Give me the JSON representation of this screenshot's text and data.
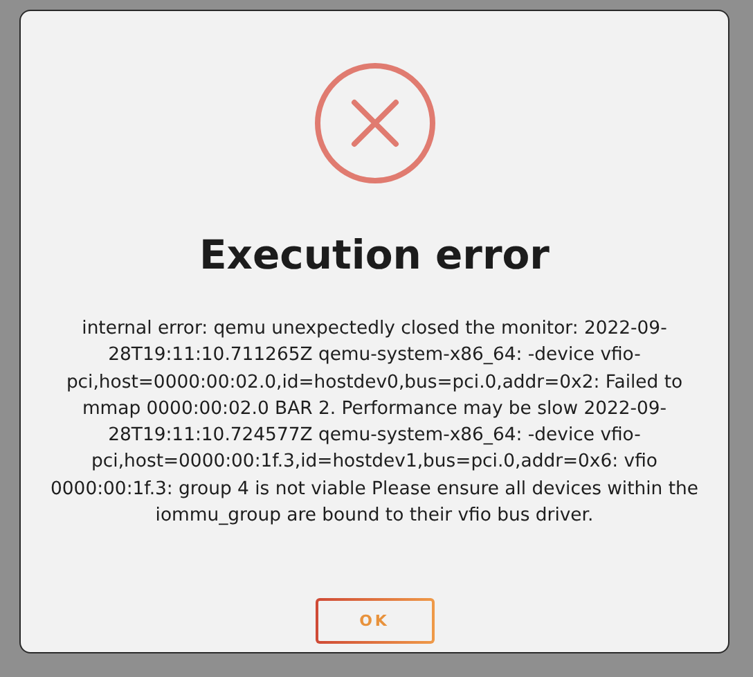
{
  "dialog": {
    "title": "Execution error",
    "message": "internal error: qemu unexpectedly closed the monitor: 2022-09-28T19:11:10.711265Z qemu-system-x86_64: -device vfio-pci,host=0000:00:02.0,id=hostdev0,bus=pci.0,addr=0x2: Failed to mmap 0000:00:02.0 BAR 2. Performance may be slow 2022-09-28T19:11:10.724577Z qemu-system-x86_64: -device vfio-pci,host=0000:00:1f.3,id=hostdev1,bus=pci.0,addr=0x6: vfio 0000:00:1f.3: group 4 is not viable Please ensure all devices within the iommu_group are bound to their vfio bus driver.",
    "buttons": [
      "OK"
    ]
  }
}
